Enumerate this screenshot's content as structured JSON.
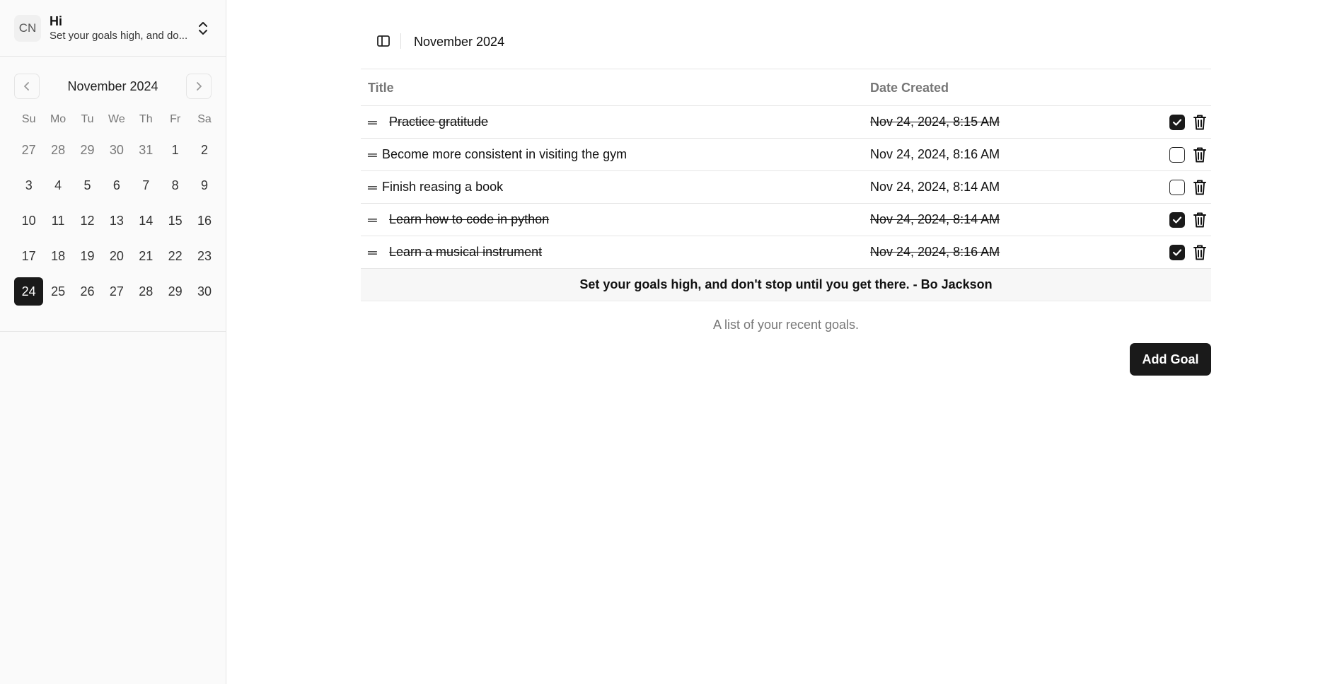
{
  "sidebar": {
    "avatar_initials": "CN",
    "user_name": "Hi",
    "user_subtitle": "Set your goals high, and do...",
    "calendar": {
      "month_label": "November 2024",
      "weekdays": [
        "Su",
        "Mo",
        "Tu",
        "We",
        "Th",
        "Fr",
        "Sa"
      ],
      "weeks": [
        [
          "27",
          "28",
          "29",
          "30",
          "31",
          "1",
          "2"
        ],
        [
          "3",
          "4",
          "5",
          "6",
          "7",
          "8",
          "9"
        ],
        [
          "10",
          "11",
          "12",
          "13",
          "14",
          "15",
          "16"
        ],
        [
          "17",
          "18",
          "19",
          "20",
          "21",
          "22",
          "23"
        ],
        [
          "24",
          "25",
          "26",
          "27",
          "28",
          "29",
          "30"
        ]
      ],
      "selected_day": "24"
    }
  },
  "header": {
    "title": "November 2024"
  },
  "table": {
    "columns": {
      "title": "Title",
      "date_created": "Date Created"
    },
    "rows": [
      {
        "title": "Practice gratitude",
        "date": "Nov 24, 2024, 8:15 AM",
        "completed": true
      },
      {
        "title": "Become more consistent in visiting the gym",
        "date": "Nov 24, 2024, 8:16 AM",
        "completed": false
      },
      {
        "title": "Finish reasing a book",
        "date": "Nov 24, 2024, 8:14 AM",
        "completed": false
      },
      {
        "title": "Learn how to code in python",
        "date": "Nov 24, 2024, 8:14 AM",
        "completed": true
      },
      {
        "title": "Learn a musical instrument",
        "date": "Nov 24, 2024, 8:16 AM",
        "completed": true
      }
    ],
    "quote": "Set your goals high, and don't stop until you get there. - Bo Jackson",
    "caption": "A list of your recent goals."
  },
  "actions": {
    "add_goal_label": "Add Goal"
  },
  "icons": {
    "drag_handle_glyph": "═"
  },
  "colors": {
    "primary": "#1a1a1a",
    "sidebar_bg": "#fafafa",
    "muted_text": "#777777",
    "border": "#e5e5e5"
  }
}
